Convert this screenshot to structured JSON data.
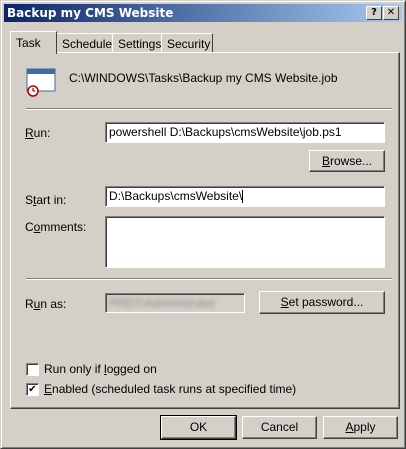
{
  "window": {
    "title": "Backup my CMS Website",
    "help_glyph": "?",
    "close_glyph": "✕"
  },
  "tabs": [
    {
      "label": "Task",
      "active": true
    },
    {
      "label": "Schedule",
      "active": false
    },
    {
      "label": "Settings",
      "active": false
    },
    {
      "label": "Security",
      "active": false
    }
  ],
  "task": {
    "path": "C:\\WINDOWS\\Tasks\\Backup my CMS Website.job",
    "icon": "scheduled-task-icon",
    "run_label_u": "R",
    "run_label_rest": "un:",
    "run_value": "powershell D:\\Backups\\cmsWebsite\\job.ps1",
    "browse_u": "B",
    "browse_rest": "rowse...",
    "startin_pre": "S",
    "startin_u": "t",
    "startin_rest": "art in:",
    "startin_value": "D:\\Backups\\cmsWebsite\\",
    "comments_pre": "C",
    "comments_u": "o",
    "comments_rest": "mments:",
    "comments_value": "",
    "runas_pre": "R",
    "runas_u": "u",
    "runas_rest": "n as:",
    "runas_value": "PRDT\\Administrator",
    "setpw_u": "S",
    "setpw_rest": "et password...",
    "run_logged_pre": "Run only if ",
    "run_logged_u": "l",
    "run_logged_rest": "ogged on",
    "run_logged_checked": false,
    "enabled_u": "E",
    "enabled_rest": "nabled (scheduled task runs at specified time)",
    "enabled_checked": true,
    "check_glyph": "✔"
  },
  "buttons": {
    "ok": "OK",
    "cancel": "Cancel",
    "apply_u": "A",
    "apply_rest": "pply"
  }
}
